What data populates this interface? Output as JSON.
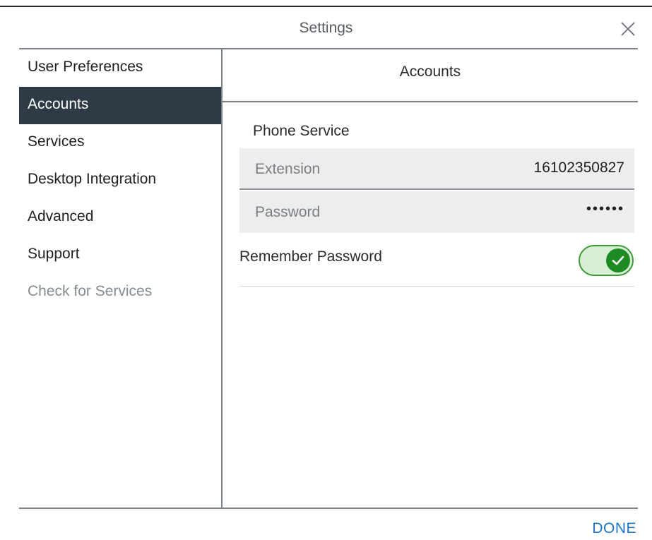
{
  "window": {
    "title": "Settings"
  },
  "icons": {
    "close": "close-icon",
    "check": "check-icon"
  },
  "sidebar": {
    "items": [
      {
        "label": "User Preferences",
        "active": false,
        "muted": false
      },
      {
        "label": "Accounts",
        "active": true,
        "muted": false
      },
      {
        "label": "Services",
        "active": false,
        "muted": false
      },
      {
        "label": "Desktop Integration",
        "active": false,
        "muted": false
      },
      {
        "label": "Advanced",
        "active": false,
        "muted": false
      },
      {
        "label": "Support",
        "active": false,
        "muted": false
      },
      {
        "label": "Check for Services",
        "active": false,
        "muted": true
      }
    ]
  },
  "panel": {
    "title": "Accounts",
    "section": "Phone Service",
    "fields": {
      "extension": {
        "label": "Extension",
        "value": "16102350827"
      },
      "password": {
        "label": "Password",
        "value": "••••••"
      }
    },
    "remember_password": {
      "label": "Remember Password",
      "enabled": true
    }
  },
  "footer": {
    "done_label": "DONE"
  },
  "colors": {
    "sidebar_active_bg": "#2e3a45",
    "toggle_on": "#1e8a22",
    "link_blue": "#1b73c6"
  }
}
